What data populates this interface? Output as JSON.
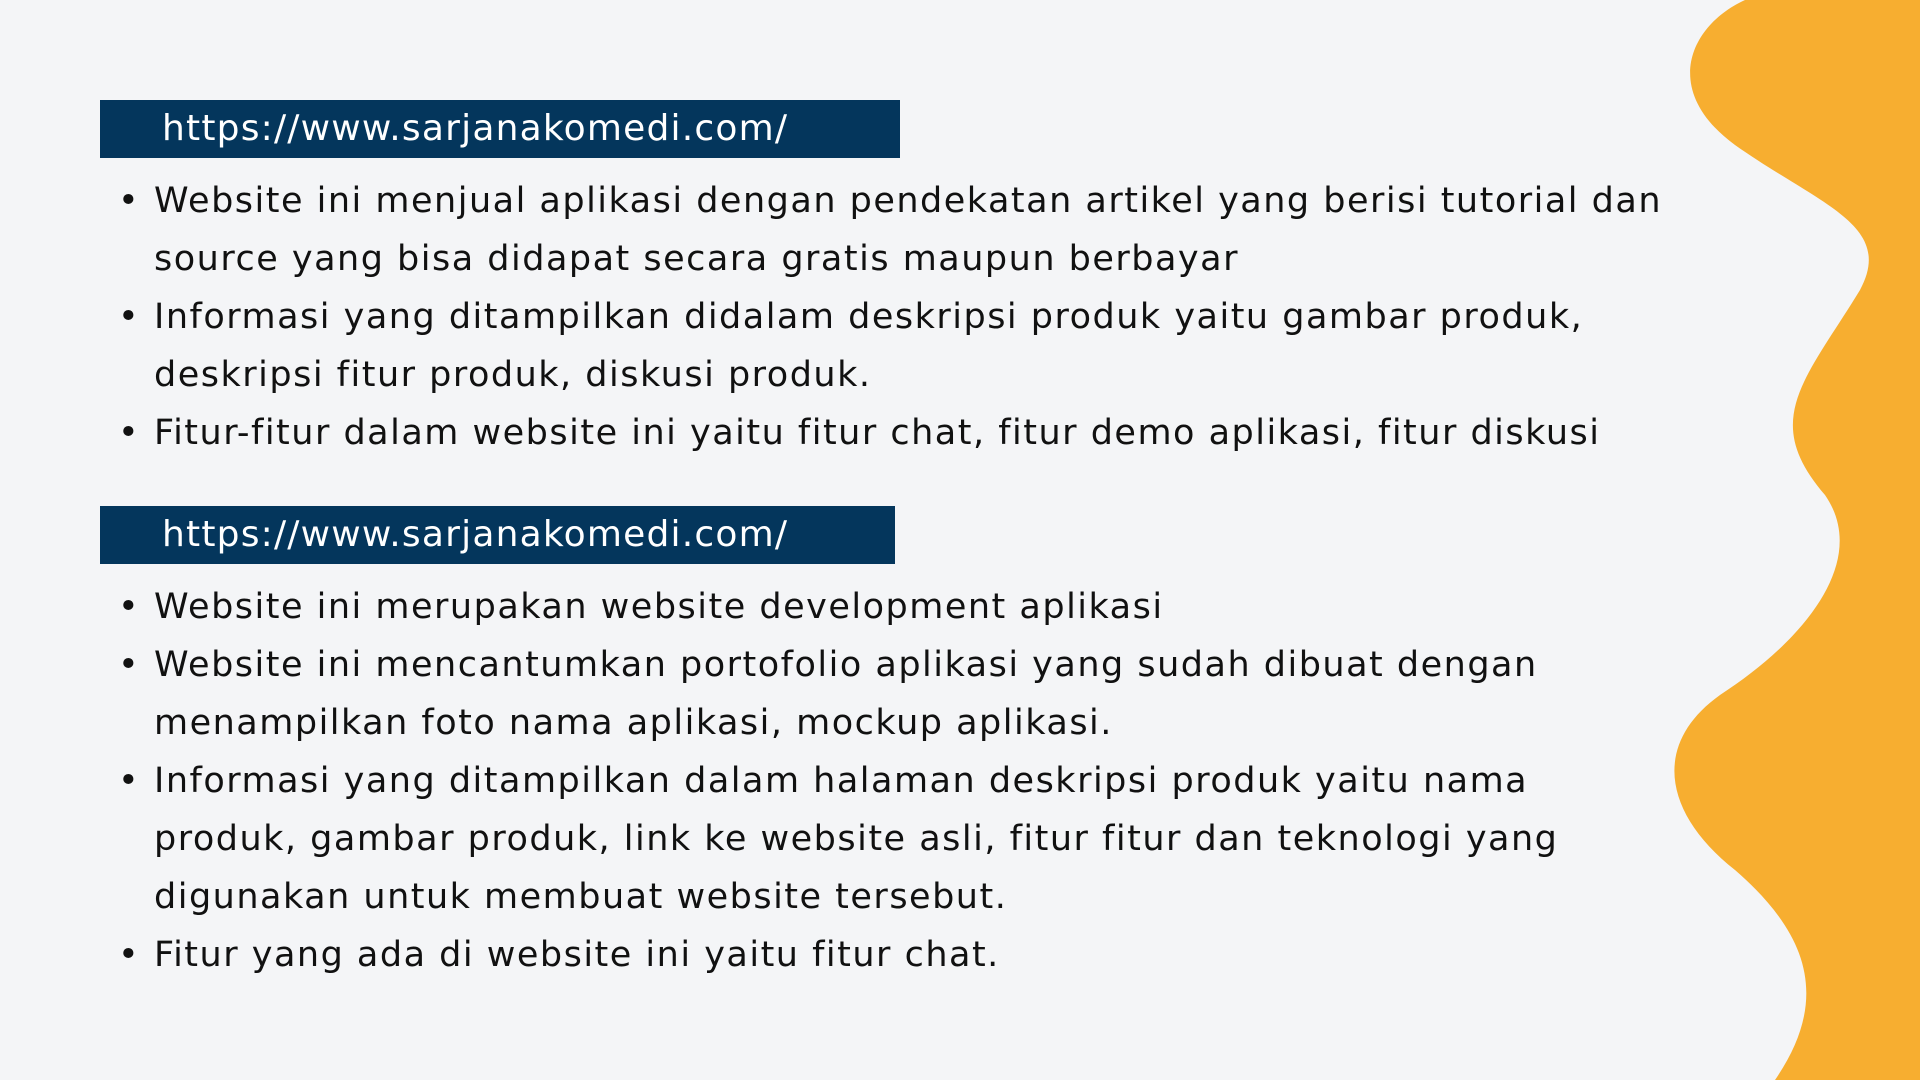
{
  "sections": [
    {
      "url_label": "https://www.sarjanakomedi.com/",
      "bullets": [
        "Website ini menjual aplikasi dengan pendekatan artikel yang berisi tutorial dan source yang bisa didapat secara gratis maupun berbayar",
        "Informasi yang ditampilkan didalam deskripsi produk yaitu gambar produk, deskripsi fitur produk, diskusi produk.",
        "Fitur-fitur dalam website ini yaitu fitur chat, fitur demo aplikasi, fitur diskusi"
      ]
    },
    {
      "url_label": "https://www.sarjanakomedi.com/",
      "bullets": [
        "Website ini merupakan website development aplikasi",
        "Website ini mencantumkan portofolio aplikasi yang sudah dibuat dengan menampilkan foto nama aplikasi, mockup aplikasi.",
        "Informasi yang ditampilkan dalam halaman deskripsi produk yaitu nama produk, gambar produk, link ke website asli, fitur fitur dan teknologi yang digunakan untuk membuat website tersebut.",
        "Fitur yang ada di website ini yaitu fitur chat."
      ]
    }
  ],
  "colors": {
    "background": "#f4f5f7",
    "url_bar": "#04365c",
    "accent_wave": "#f7ae30",
    "text": "#111111"
  }
}
